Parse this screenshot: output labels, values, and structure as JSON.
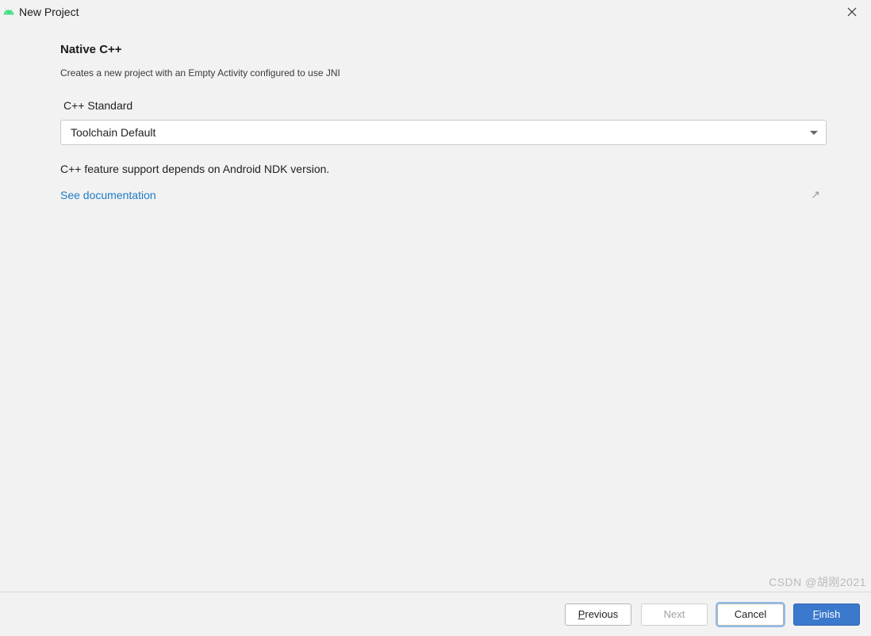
{
  "window": {
    "title": "New Project"
  },
  "page": {
    "heading": "Native C++",
    "subheading": "Creates a new project with an Empty Activity configured to use JNI",
    "field_label": "C++ Standard",
    "select_value": "Toolchain Default",
    "info_text": "C++ feature support depends on Android NDK version.",
    "doc_link": "See documentation"
  },
  "footer": {
    "previous": "Previous",
    "next": "Next",
    "cancel": "Cancel",
    "finish": "Finish"
  },
  "watermark": "CSDN @胡刚2021"
}
